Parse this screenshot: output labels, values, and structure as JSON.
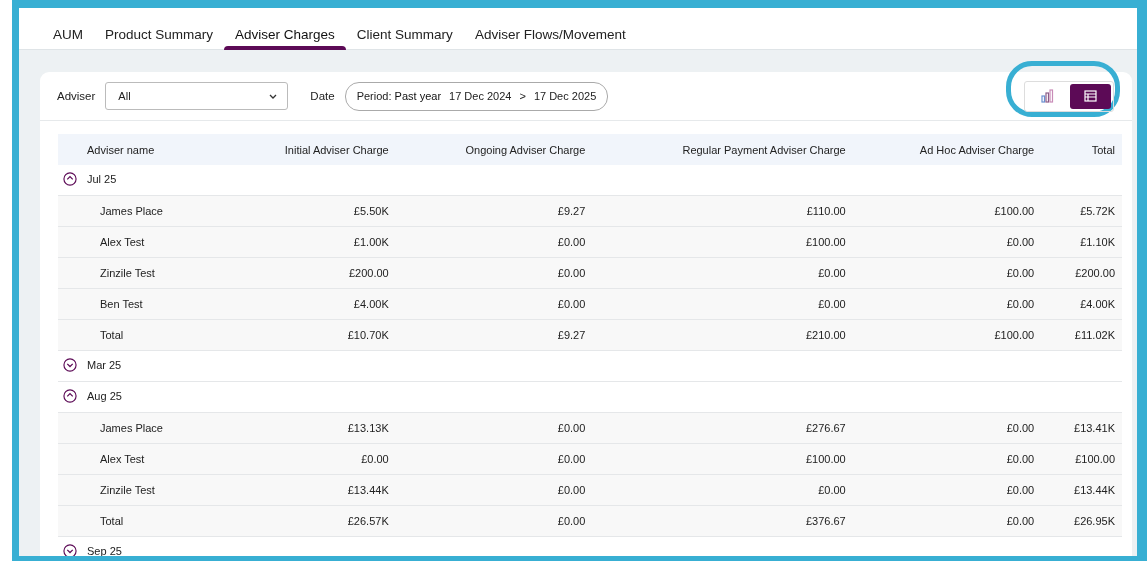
{
  "tabs": [
    {
      "label": "AUM",
      "selected": false
    },
    {
      "label": "Product Summary",
      "selected": false
    },
    {
      "label": "Adviser Charges",
      "selected": true
    },
    {
      "label": "Client Summary",
      "selected": false
    },
    {
      "label": "Adviser Flows/Movement",
      "selected": false
    }
  ],
  "filters": {
    "adviser": {
      "label": "Adviser",
      "value": "All"
    },
    "date": {
      "label": "Date",
      "period_label": "Period:",
      "period": "Past year",
      "from": "17 Dec 2024",
      "separator": ">",
      "to": "17 Dec 2025"
    }
  },
  "view_toggle": [
    {
      "kind": "chart",
      "selected": false
    },
    {
      "kind": "table",
      "selected": true
    }
  ],
  "annotation": {
    "highlight_view_toggle": true
  },
  "table": {
    "columns": [
      "Adviser name",
      "Initial Adviser Charge",
      "Ongoing Adviser Charge",
      "Regular Payment Adviser Charge",
      "Ad Hoc Adviser Charge",
      "Total"
    ],
    "groups": [
      {
        "label": "Jul 25",
        "expanded": true,
        "rows": [
          {
            "cells": [
              "James Place",
              "£5.50K",
              "£9.27",
              "£110.00",
              "£100.00",
              "£5.72K"
            ]
          },
          {
            "cells": [
              "Alex Test",
              "£1.00K",
              "£0.00",
              "£100.00",
              "£0.00",
              "£1.10K"
            ]
          },
          {
            "cells": [
              "Zinzile Test",
              "£200.00",
              "£0.00",
              "£0.00",
              "£0.00",
              "£200.00"
            ]
          },
          {
            "cells": [
              "Ben Test",
              "£4.00K",
              "£0.00",
              "£0.00",
              "£0.00",
              "£4.00K"
            ]
          },
          {
            "cells": [
              "Total",
              "£10.70K",
              "£9.27",
              "£210.00",
              "£100.00",
              "£11.02K"
            ]
          }
        ]
      },
      {
        "label": "Mar 25",
        "expanded": false
      },
      {
        "label": "Aug 25",
        "expanded": true,
        "rows": [
          {
            "cells": [
              "James Place",
              "£13.13K",
              "£0.00",
              "£276.67",
              "£0.00",
              "£13.41K"
            ]
          },
          {
            "cells": [
              "Alex Test",
              "£0.00",
              "£0.00",
              "£100.00",
              "£0.00",
              "£100.00"
            ]
          },
          {
            "cells": [
              "Zinzile Test",
              "£13.44K",
              "£0.00",
              "£0.00",
              "£0.00",
              "£13.44K"
            ]
          },
          {
            "cells": [
              "Total",
              "£26.57K",
              "£0.00",
              "£376.67",
              "£0.00",
              "£26.95K"
            ]
          }
        ]
      },
      {
        "label": "Sep 25",
        "expanded": false
      }
    ]
  }
}
